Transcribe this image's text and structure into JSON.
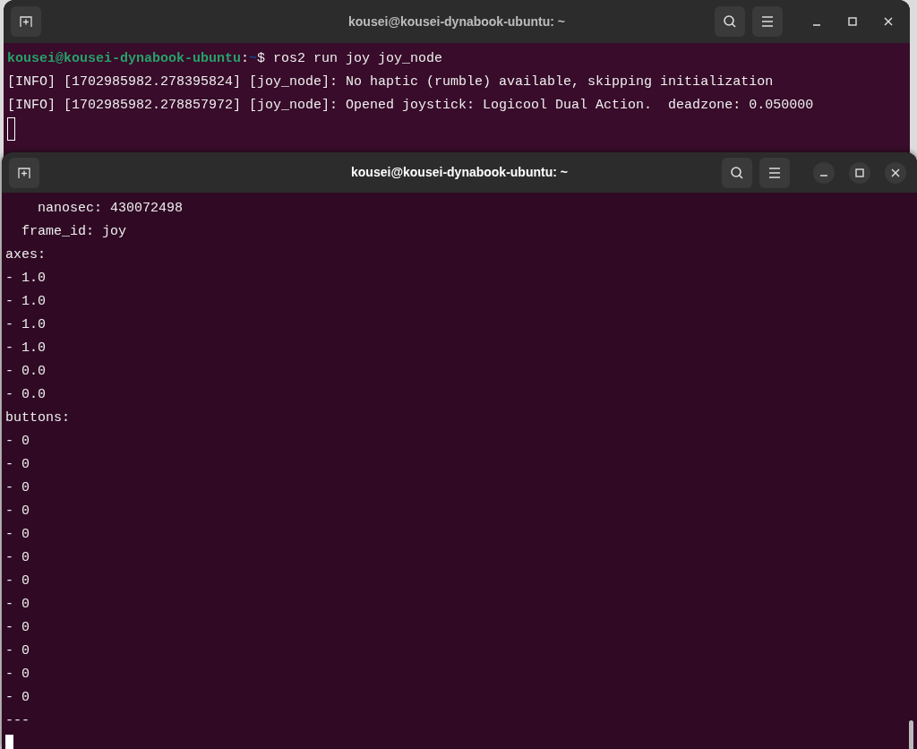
{
  "windows": [
    {
      "title": "kousei@kousei-dynabook-ubuntu: ~",
      "focused": false,
      "lines": [
        {
          "kind": "prompt",
          "user_host": "kousei@kousei-dynabook-ubuntu",
          "separator": ":",
          "path": "~",
          "command": "$ ros2 run joy joy_node"
        },
        {
          "kind": "output",
          "text": "[INFO] [1702985982.278395824] [joy_node]: No haptic (rumble) available, skipping initialization"
        },
        {
          "kind": "output",
          "text": "[INFO] [1702985982.278857972] [joy_node]: Opened joystick: Logicool Dual Action.  deadzone: 0.050000"
        }
      ]
    },
    {
      "title": "kousei@kousei-dynabook-ubuntu: ~",
      "focused": true,
      "lines": [
        {
          "kind": "output",
          "text": "    nanosec: 430072498"
        },
        {
          "kind": "output",
          "text": "  frame_id: joy"
        },
        {
          "kind": "output",
          "text": "axes:"
        },
        {
          "kind": "output",
          "text": "- 1.0"
        },
        {
          "kind": "output",
          "text": "- 1.0"
        },
        {
          "kind": "output",
          "text": "- 1.0"
        },
        {
          "kind": "output",
          "text": "- 1.0"
        },
        {
          "kind": "output",
          "text": "- 0.0"
        },
        {
          "kind": "output",
          "text": "- 0.0"
        },
        {
          "kind": "output",
          "text": "buttons:"
        },
        {
          "kind": "output",
          "text": "- 0"
        },
        {
          "kind": "output",
          "text": "- 0"
        },
        {
          "kind": "output",
          "text": "- 0"
        },
        {
          "kind": "output",
          "text": "- 0"
        },
        {
          "kind": "output",
          "text": "- 0"
        },
        {
          "kind": "output",
          "text": "- 0"
        },
        {
          "kind": "output",
          "text": "- 0"
        },
        {
          "kind": "output",
          "text": "- 0"
        },
        {
          "kind": "output",
          "text": "- 0"
        },
        {
          "kind": "output",
          "text": "- 0"
        },
        {
          "kind": "output",
          "text": "- 0"
        },
        {
          "kind": "output",
          "text": "- 0"
        },
        {
          "kind": "output",
          "text": "---"
        }
      ]
    }
  ]
}
